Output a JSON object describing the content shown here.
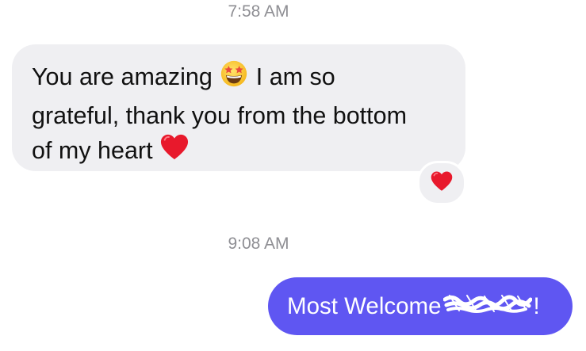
{
  "conversation": {
    "timestamp_1": "7:58 AM",
    "incoming": {
      "line1_a": "You are amazing",
      "line1_b": "I am so",
      "line2": "grateful, thank you from the bottom",
      "line3": "of my heart",
      "emoji_1": "star-struck-emoji",
      "emoji_2": "red-heart-emoji",
      "reaction": "red-heart-emoji"
    },
    "timestamp_2": "9:08 AM",
    "outgoing": {
      "text_before": "Most Welcome",
      "text_after": "!",
      "redaction": "scribbled-out-name"
    }
  },
  "colors": {
    "incoming_bubble": "#efeff2",
    "outgoing_bubble": "#5f56f2",
    "timestamp": "#8e8e93",
    "heart": "#e8192c"
  }
}
